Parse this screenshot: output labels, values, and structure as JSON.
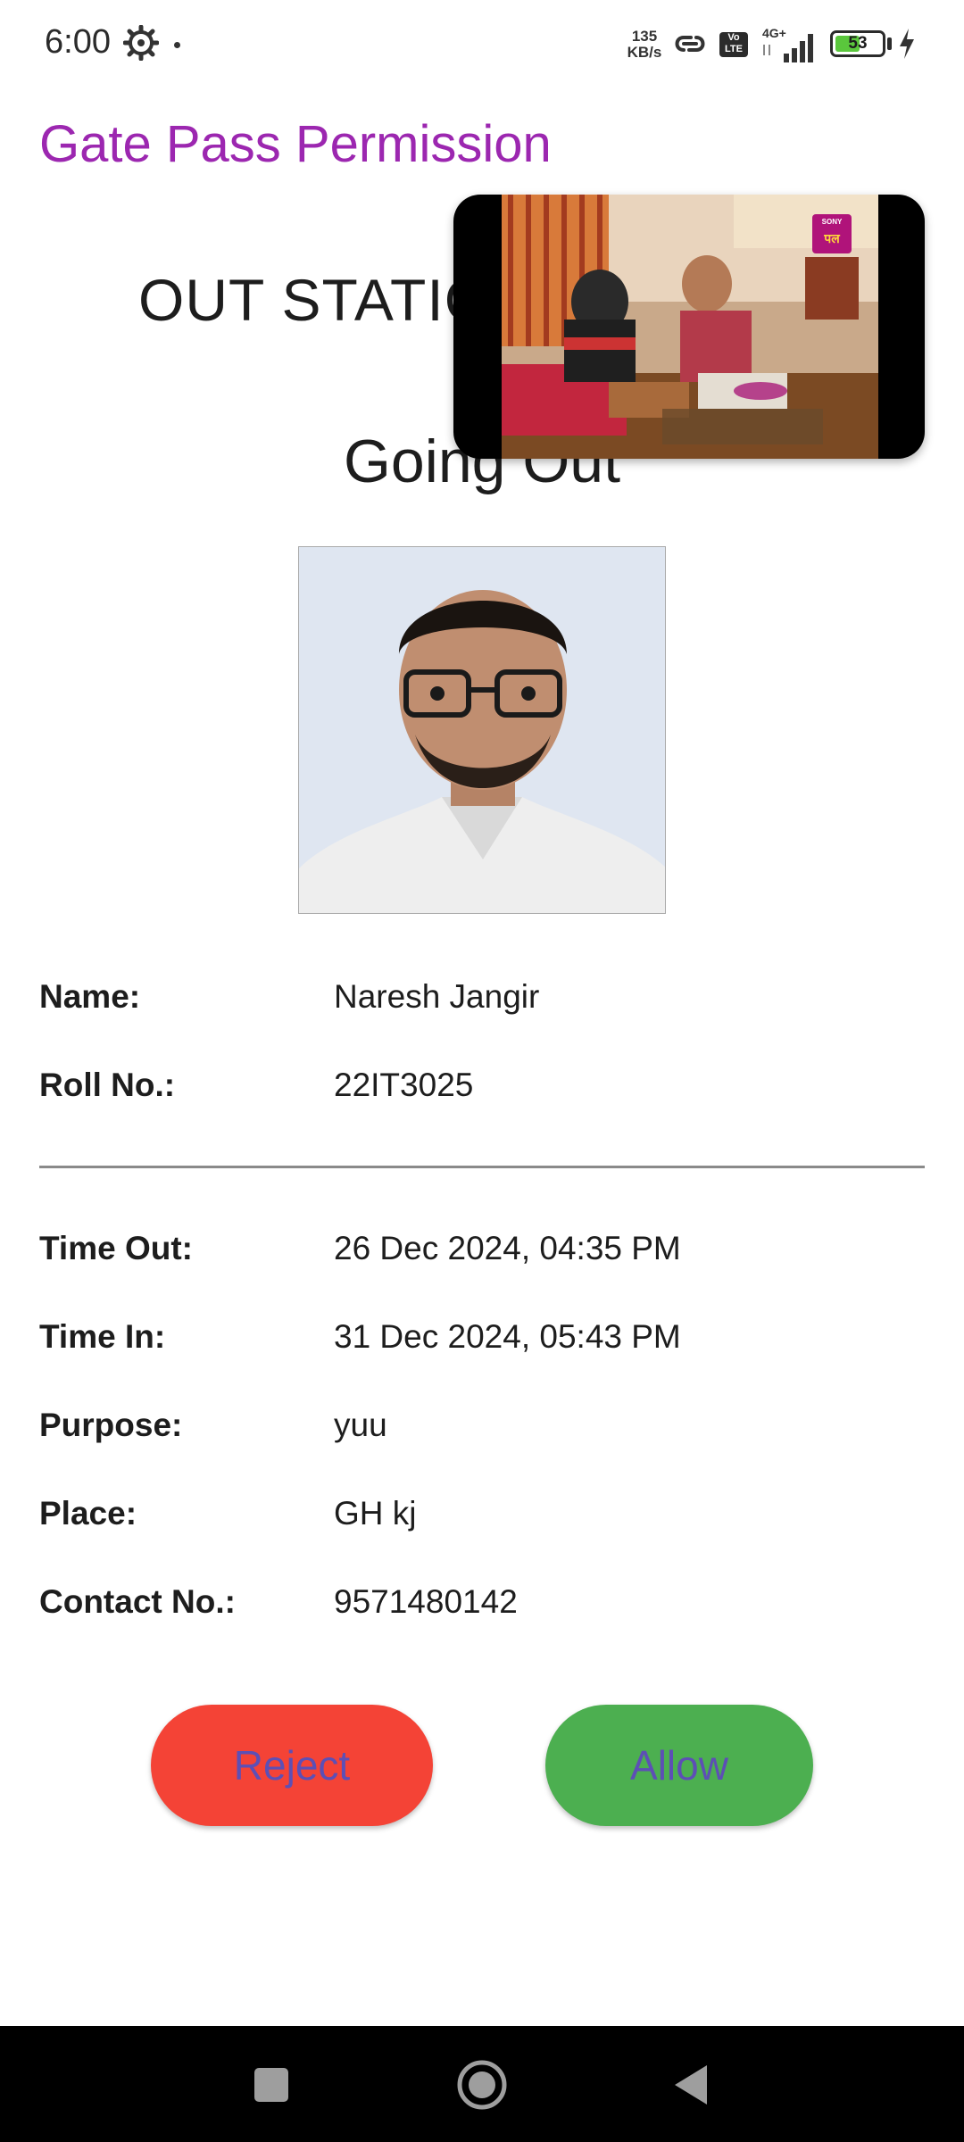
{
  "status_bar": {
    "time": "6:00",
    "net_speed_value": "135",
    "net_speed_unit": "KB/s",
    "volte_label": "Vo LTE",
    "network_type": "4G+",
    "battery_level": 53,
    "battery_text": "53",
    "icons": [
      "gear-icon",
      "link-icon",
      "volte-icon",
      "signal-icon",
      "battery-icon",
      "charging-icon"
    ]
  },
  "app_bar": {
    "title": "Gate Pass Permission"
  },
  "pass": {
    "category": "OUT STATIC",
    "direction": "Going Out"
  },
  "pip": {
    "channel_brand": "SONY",
    "channel_name": "पल"
  },
  "details": {
    "name_label": "Name:",
    "name_value": "Naresh Jangir",
    "roll_label": "Roll No.:",
    "roll_value": "22IT3025",
    "time_out_label": "Time Out:",
    "time_out_value": "26 Dec 2024, 04:35 PM",
    "time_in_label": "Time In:",
    "time_in_value": "31 Dec 2024, 05:43 PM",
    "purpose_label": "Purpose:",
    "purpose_value": "yuu",
    "place_label": "Place:",
    "place_value": "GH kj",
    "contact_label": "Contact No.:",
    "contact_value": "9571480142"
  },
  "actions": {
    "reject_label": "Reject",
    "allow_label": "Allow"
  },
  "colors": {
    "title": "#9c27b0",
    "reject": "#f44336",
    "allow": "#4caf50",
    "button_text": "#5d4fb5"
  },
  "nav_bar": {
    "icons": [
      "recents-icon",
      "home-icon",
      "back-icon"
    ]
  }
}
